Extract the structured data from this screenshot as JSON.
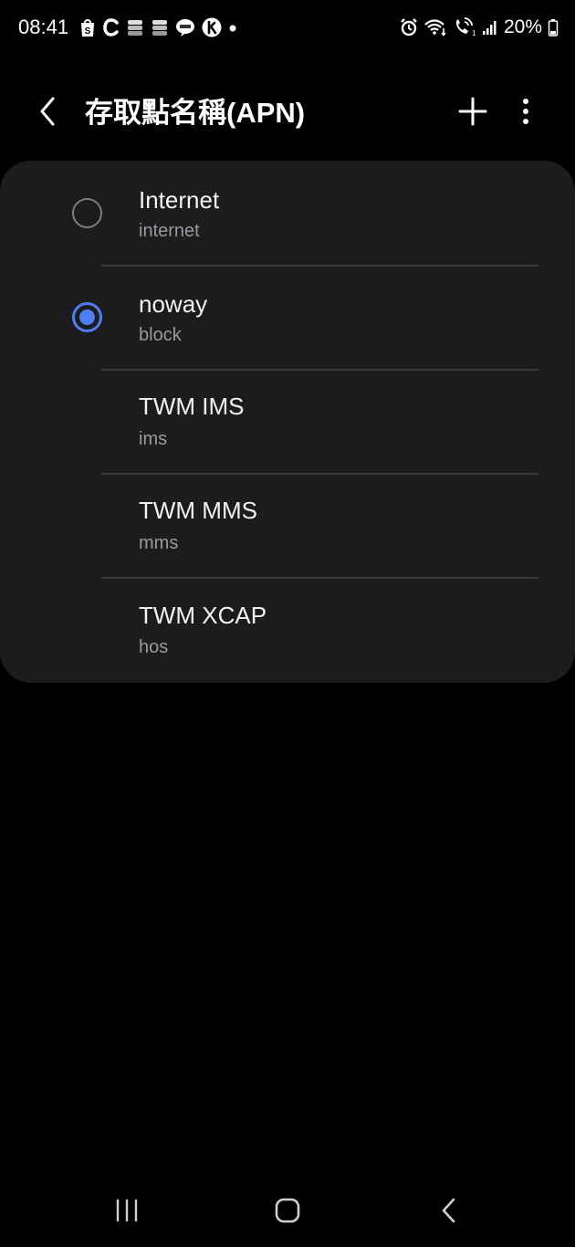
{
  "status_bar": {
    "time": "08:41",
    "battery": "20%",
    "notification_icons": [
      "shopping-bag-icon",
      "c-app-icon",
      "stack-icon",
      "stack-icon",
      "line-icon",
      "k-app-icon",
      "dot-icon"
    ],
    "system_icons": [
      "alarm-icon",
      "wifi-icon",
      "wifi-calling-icon",
      "signal-icon",
      "battery-icon"
    ]
  },
  "app_bar": {
    "title": "存取點名稱(APN)",
    "back_icon": "chevron-left-icon",
    "add_icon": "plus-icon",
    "more_icon": "more-vertical-icon"
  },
  "apn_list": [
    {
      "name": "Internet",
      "type": "internet",
      "has_radio": true,
      "selected": false
    },
    {
      "name": "noway",
      "type": "block",
      "has_radio": true,
      "selected": true
    },
    {
      "name": "TWM IMS",
      "type": "ims",
      "has_radio": false,
      "selected": false
    },
    {
      "name": "TWM MMS",
      "type": "mms",
      "has_radio": false,
      "selected": false
    },
    {
      "name": "TWM XCAP",
      "type": "hos",
      "has_radio": false,
      "selected": false
    }
  ],
  "nav_bar": {
    "recents_icon": "recents-icon",
    "home_icon": "home-icon",
    "back_icon": "back-icon"
  },
  "colors": {
    "background": "#000000",
    "card": "#1c1c1e",
    "accent": "#4e7ef2",
    "secondary_text": "#9a9a9e",
    "divider": "#3a3a3c"
  }
}
